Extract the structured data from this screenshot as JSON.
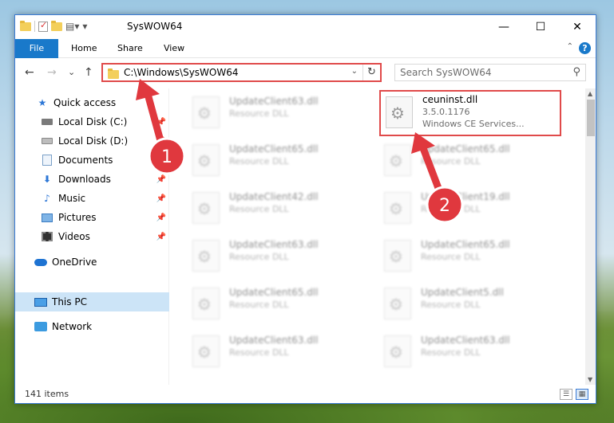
{
  "window": {
    "title": "SysWOW64",
    "minimize_glyph": "—",
    "maximize_glyph": "☐",
    "close_glyph": "✕"
  },
  "ribbon": {
    "tabs": [
      {
        "label": "File"
      },
      {
        "label": "Home"
      },
      {
        "label": "Share"
      },
      {
        "label": "View"
      }
    ],
    "help_glyph": "?",
    "collapse_glyph": "⌃"
  },
  "nav": {
    "back_glyph": "←",
    "forward_glyph": "→",
    "recent_glyph": "⌄",
    "up_glyph": "↑",
    "address": "C:\\Windows\\SysWOW64",
    "address_dropdown_glyph": "⌄",
    "refresh_glyph": "↻",
    "search_placeholder": "Search SysWOW64",
    "search_glyph": "⚲"
  },
  "sidebar": {
    "items": [
      {
        "label": "Quick access",
        "icon": "star-icon"
      },
      {
        "label": "Local Disk (C:)",
        "icon": "disk-icon",
        "pinned": true
      },
      {
        "label": "Local Disk (D:)",
        "icon": "disk-icon",
        "pinned": true
      },
      {
        "label": "Documents",
        "icon": "documents-icon",
        "pinned": true
      },
      {
        "label": "Downloads",
        "icon": "downloads-icon",
        "pinned": true
      },
      {
        "label": "Music",
        "icon": "music-icon",
        "pinned": true
      },
      {
        "label": "Pictures",
        "icon": "pictures-icon",
        "pinned": true
      },
      {
        "label": "Videos",
        "icon": "videos-icon",
        "pinned": true
      },
      {
        "label": "OneDrive",
        "icon": "onedrive-icon"
      },
      {
        "label": "This PC",
        "icon": "pc-icon",
        "selected": true
      },
      {
        "label": "Network",
        "icon": "network-icon"
      }
    ],
    "pin_glyph": "📌"
  },
  "files": {
    "left_column": [
      {
        "name": "UpdateClient63.dll",
        "type": "Resource DLL"
      },
      {
        "name": "UpdateClient65.dll",
        "type": "Resource DLL"
      },
      {
        "name": "UpdateClient42.dll",
        "type": "Resource DLL"
      },
      {
        "name": "UpdateClient63.dll",
        "type": "Resource DLL"
      },
      {
        "name": "UpdateClient65.dll",
        "type": "Resource DLL"
      },
      {
        "name": "UpdateClient63.dll",
        "type": "Resource DLL"
      }
    ],
    "right_column": [
      {
        "name": "ceuninst.dll",
        "version": "3.5.0.1176",
        "description": "Windows CE Services..."
      },
      {
        "name": "UpdateClient65.dll",
        "type": "Resource DLL"
      },
      {
        "name": "UpdateClient19.dll",
        "type": "Resource DLL"
      },
      {
        "name": "UpdateClient65.dll",
        "type": "Resource DLL"
      },
      {
        "name": "UpdateClient5.dll",
        "type": "Resource DLL"
      },
      {
        "name": "UpdateClient63.dll",
        "type": "Resource DLL"
      }
    ]
  },
  "status": {
    "item_count": "141 items"
  },
  "callouts": [
    {
      "number": "1"
    },
    {
      "number": "2"
    }
  ],
  "colors": {
    "accent": "#1979ca",
    "highlight_border": "#e04a4a",
    "callout": "#e0383e",
    "selection": "#cce4f7"
  }
}
